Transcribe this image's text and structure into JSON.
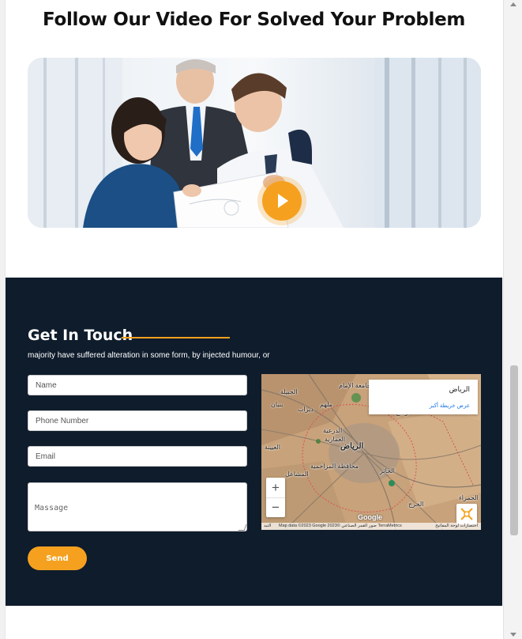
{
  "video_section": {
    "title": "Follow Our Video For Solved Your Problem",
    "play_icon": "play-icon"
  },
  "contact": {
    "title": "Get In Touch",
    "subtitle": "majority have suffered alteration in some form, by injected humour, or",
    "fields": {
      "name_placeholder": "Name",
      "phone_placeholder": "Phone Number",
      "email_placeholder": "Email",
      "message_placeholder": "Massage"
    },
    "send_label": "Send"
  },
  "map": {
    "info_title": "الرياض",
    "info_link": "عرض خريطة أكبر",
    "zoom_in": "+",
    "zoom_out": "−",
    "google": "Google",
    "footer_left": "التبد",
    "footer_text": "Map data ©2023 Google 2023© صور القمر الصناعي TerraMetrics",
    "footer_right": "اختصارات لوحة المفاتيح",
    "labels": {
      "riyadh": "الرياض",
      "diriyah": "الدرعية",
      "malham": "ملهم",
      "deriah": "ديراب",
      "ammariyah": "العمارية",
      "jubailah": "الجبيلة",
      "banban": "بنبان",
      "shamisi": "المشاعل",
      "al_haer": "الحائر",
      "kharj": "الخرج",
      "university": "جامعة الإمام",
      "uyaynah": "العيينة",
      "muzahmiyah": "محافظة المزاحمية",
      "hamra": "الحمراء",
      "rumah": "رماح"
    },
    "accent_color": "#f5a11f"
  },
  "colors": {
    "accent": "#f5a11f",
    "contact_bg": "#0f1c2c"
  }
}
